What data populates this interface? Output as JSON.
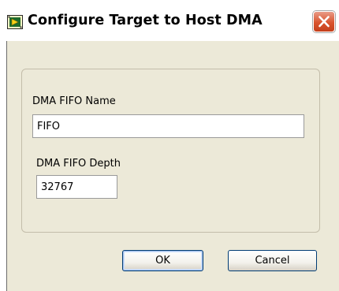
{
  "window": {
    "title": "Configure Target to Host DMA",
    "app_icon": "labview-fpga-icon",
    "close_icon": "close-x-icon"
  },
  "form": {
    "name_label": "DMA FIFO Name",
    "name_value": "FIFO",
    "depth_label": "DMA FIFO Depth",
    "depth_value": "32767"
  },
  "buttons": {
    "ok_label": "OK",
    "cancel_label": "Cancel"
  },
  "colors": {
    "dialog_background": "#ece9d8",
    "close_button": "#d9542e",
    "button_border": "#003c74"
  }
}
